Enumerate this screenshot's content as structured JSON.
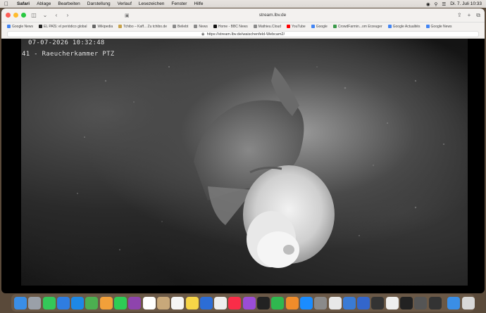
{
  "menubar": {
    "app": "Safari",
    "items": [
      "Ablage",
      "Bearbeiten",
      "Darstellung",
      "Verlauf",
      "Lesezeichen",
      "Fenster",
      "Hilfe"
    ],
    "clock": "Di. 7. Juli  10:33"
  },
  "browser": {
    "tab_title": "stream.lbv.de",
    "url": "https://stream.lbv.de/waischenfeld-Webcam2/",
    "bookmarks": [
      {
        "label": "Google News",
        "color": "#4285f4"
      },
      {
        "label": "EL PAÍS: el periódico global",
        "color": "#222222"
      },
      {
        "label": "Wikipedia",
        "color": "#666666"
      },
      {
        "label": "Tchibo – Kaff... Zu tchibo.de",
        "color": "#c8a24a"
      },
      {
        "label": "Beliebt",
        "color": "#8a8a8a"
      },
      {
        "label": "News",
        "color": "#8a8a8a"
      },
      {
        "label": "Home - BBC News",
        "color": "#111111"
      },
      {
        "label": "Mathieu.Cloud",
        "color": "#8a8a8a"
      },
      {
        "label": "YouTube",
        "color": "#ff0000"
      },
      {
        "label": "Google",
        "color": "#4285f4"
      },
      {
        "label": "CrowdFarmin...om Erzeuger",
        "color": "#3a9a4a"
      },
      {
        "label": "Google Actualités",
        "color": "#4285f4"
      },
      {
        "label": "Google News",
        "color": "#4285f4"
      }
    ]
  },
  "video": {
    "timestamp": "07-07-2026 10:32:48",
    "camera_label": "41 - Raeucherkammer PTZ"
  },
  "dock": {
    "icons": [
      {
        "name": "finder-icon",
        "color": "#3a8ee6"
      },
      {
        "name": "launchpad-icon",
        "color": "#9aa0a8"
      },
      {
        "name": "messages-icon",
        "color": "#34c759"
      },
      {
        "name": "mail-icon",
        "color": "#2f7de1"
      },
      {
        "name": "safari-icon",
        "color": "#1e88e5"
      },
      {
        "name": "maps-icon",
        "color": "#4caf50"
      },
      {
        "name": "photos-icon",
        "color": "#f2a03a"
      },
      {
        "name": "facetime-icon",
        "color": "#2ecc55"
      },
      {
        "name": "podcasts-icon",
        "color": "#8e44ad"
      },
      {
        "name": "calendar-icon",
        "color": "#ffffff"
      },
      {
        "name": "contacts-icon",
        "color": "#c8a87a"
      },
      {
        "name": "reminders-icon",
        "color": "#f5f5f5"
      },
      {
        "name": "notes-icon",
        "color": "#f7d547"
      },
      {
        "name": "keynote-icon",
        "color": "#2c6dd6"
      },
      {
        "name": "freeform-icon",
        "color": "#eeeeee"
      },
      {
        "name": "music-icon",
        "color": "#fa2d48"
      },
      {
        "name": "podcast-app-icon",
        "color": "#9b4dd6"
      },
      {
        "name": "tv-icon",
        "color": "#222222"
      },
      {
        "name": "numbers-icon",
        "color": "#2fb84f"
      },
      {
        "name": "pages-icon",
        "color": "#f08c2a"
      },
      {
        "name": "app-store-icon",
        "color": "#1a8cff"
      },
      {
        "name": "system-settings-icon",
        "color": "#8a8a8a"
      },
      {
        "name": "chrome-icon",
        "color": "#e8e8e8"
      },
      {
        "name": "preview-icon",
        "color": "#3a7bd5"
      },
      {
        "name": "unknown-app-icon",
        "color": "#3366cc"
      },
      {
        "name": "activity-monitor-icon",
        "color": "#333333"
      },
      {
        "name": "textedit-icon",
        "color": "#eeeeee"
      },
      {
        "name": "stocks-icon",
        "color": "#222222"
      },
      {
        "name": "disk-utility-icon",
        "color": "#555555"
      },
      {
        "name": "keychain-icon",
        "color": "#333333"
      },
      {
        "name": "downloads-folder-icon",
        "color": "#3a8ee6"
      },
      {
        "name": "trash-icon",
        "color": "#d8d8d8"
      }
    ]
  }
}
